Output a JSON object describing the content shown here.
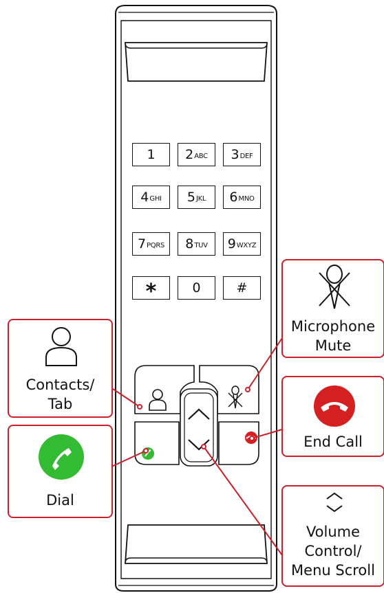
{
  "keypad": [
    {
      "digit": "1",
      "letters": ""
    },
    {
      "digit": "2",
      "letters": "ABC"
    },
    {
      "digit": "3",
      "letters": "DEF"
    },
    {
      "digit": "4",
      "letters": "GHI"
    },
    {
      "digit": "5",
      "letters": "JKL"
    },
    {
      "digit": "6",
      "letters": "MNO"
    },
    {
      "digit": "7",
      "letters": "PQRS"
    },
    {
      "digit": "8",
      "letters": "TUV"
    },
    {
      "digit": "9",
      "letters": "WXYZ"
    },
    {
      "digit": "*",
      "letters": ""
    },
    {
      "digit": "0",
      "letters": ""
    },
    {
      "digit": "#",
      "letters": ""
    }
  ],
  "callouts": {
    "contacts": {
      "line1": "Contacts/",
      "line2": "Tab",
      "icon": "person-icon"
    },
    "dial": {
      "label": "Dial",
      "icon": "phone-handset-icon",
      "color": "#33bb33"
    },
    "mute": {
      "line1": "Microphone",
      "line2": "Mute",
      "icon": "microphone-muted-icon"
    },
    "end_call": {
      "label": "End Call",
      "icon": "hang-up-icon",
      "color": "#d42020"
    },
    "volume": {
      "line1": "Volume",
      "line2": "Control/",
      "line3": "Menu Scroll",
      "icon": "chevron-up-down-icon"
    }
  },
  "colors": {
    "callout_border": "#cc1f2a",
    "dial": "#33bb33",
    "end_call": "#d42020"
  }
}
